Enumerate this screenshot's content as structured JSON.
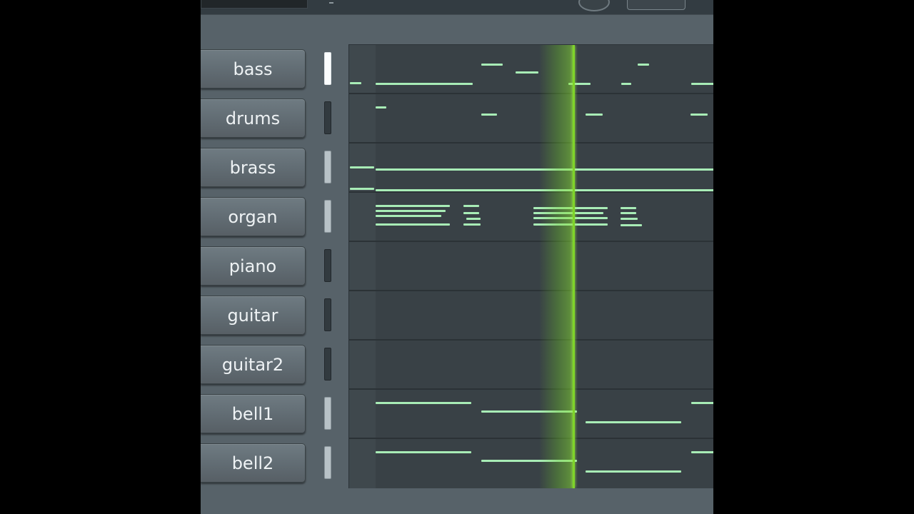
{
  "toolbar": {
    "icons": [
      "pitch-knob-icon",
      "toggle-button"
    ]
  },
  "channels": [
    {
      "label": "bass",
      "selected": true
    },
    {
      "label": "drums",
      "selected": false
    },
    {
      "label": "brass",
      "selected": true
    },
    {
      "label": "organ",
      "selected": true
    },
    {
      "label": "piano",
      "selected": false
    },
    {
      "label": "guitar",
      "selected": false
    },
    {
      "label": "guitar2",
      "selected": false
    },
    {
      "label": "bell1",
      "selected": true
    },
    {
      "label": "bell2",
      "selected": true
    }
  ],
  "colors": {
    "note": "#a8ecb6",
    "playhead": "#7fd42a",
    "grid_bg": "#394146",
    "panel_bg": "#576269"
  }
}
